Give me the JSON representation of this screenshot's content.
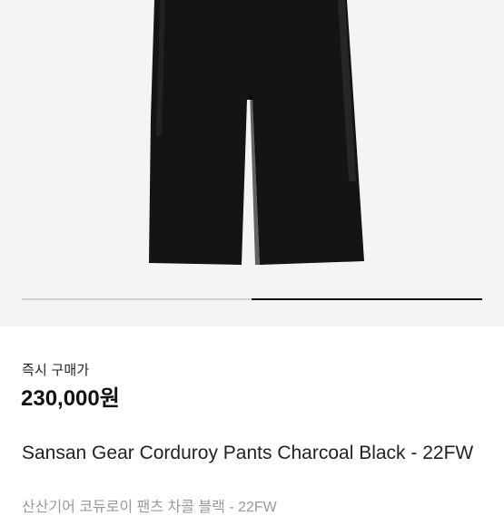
{
  "product": {
    "image_alt": "product-photo",
    "gallery_page_active": 2,
    "gallery_page_count": 2
  },
  "purchase": {
    "label": "즉시 구매가",
    "price": "230,000원"
  },
  "product_info": {
    "title": "Sansan Gear Corduroy Pants Charcoal Black - 22FW",
    "subtitle": "산산기어 코듀로이 팬츠 차콜 블랙 - 22FW"
  }
}
